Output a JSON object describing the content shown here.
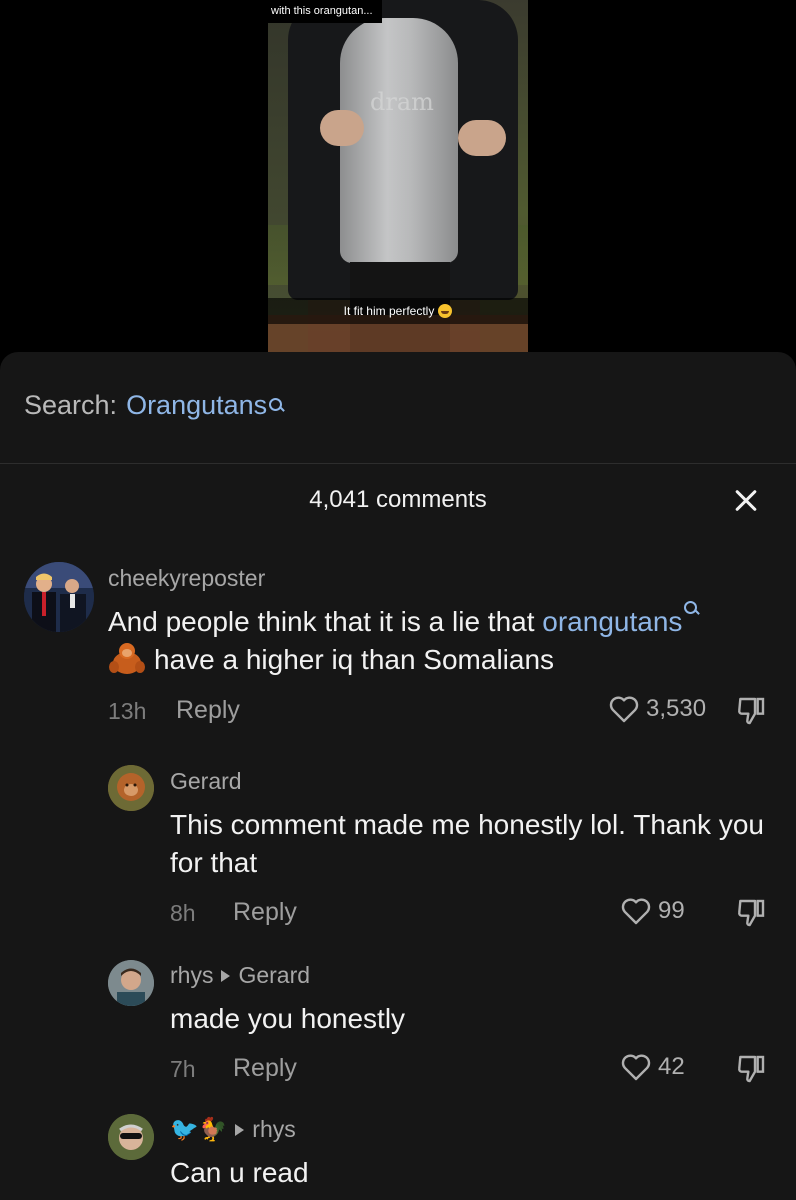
{
  "video": {
    "title": "with this orangutan...",
    "shirt_print": "dram",
    "caption": "It fit him perfectly"
  },
  "search": {
    "prefix": "Search:",
    "term": "Orangutans"
  },
  "header": {
    "count_label": "4,041 comments"
  },
  "comments": [
    {
      "username": "cheekyreposter",
      "text_before_link": "And people think that it is a lie that ",
      "link": "orangutans",
      "text_after": "have a higher iq than Somalians",
      "time": "13h",
      "reply_label": "Reply",
      "likes": "3,530"
    },
    {
      "username": "Gerard",
      "text": "This comment made me honestly lol. Thank you for that",
      "time": "8h",
      "reply_label": "Reply",
      "likes": "99"
    },
    {
      "username": "rhys",
      "reply_to": "Gerard",
      "text": "made you honestly",
      "time": "7h",
      "reply_label": "Reply",
      "likes": "42"
    },
    {
      "username": "🐦🐓",
      "reply_to": "rhys",
      "text": "Can u read"
    }
  ],
  "colors": {
    "sheet_bg": "#161616",
    "link": "#8fb6e6",
    "muted": "#a7a7a7",
    "text": "#f2f2f2"
  }
}
